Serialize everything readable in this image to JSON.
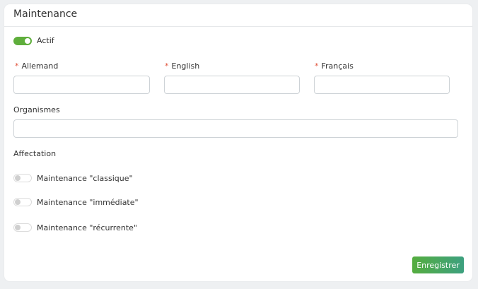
{
  "header": {
    "title": "Maintenance"
  },
  "active_toggle": {
    "label": "Actif",
    "on": true
  },
  "fields": {
    "required_mark": "*",
    "german": {
      "label": "Allemand",
      "value": ""
    },
    "english": {
      "label": "English",
      "value": ""
    },
    "french": {
      "label": "Français",
      "value": ""
    },
    "organisms": {
      "label": "Organismes",
      "value": ""
    }
  },
  "assignment": {
    "title": "Affectation",
    "options": [
      {
        "label": "Maintenance \"classique\"",
        "on": false
      },
      {
        "label": "Maintenance \"immédiate\"",
        "on": false
      },
      {
        "label": "Maintenance \"récurrente\"",
        "on": false
      }
    ]
  },
  "actions": {
    "save_label": "Enregistrer"
  },
  "colors": {
    "accent_green": "#5fae3c",
    "button_gradient_end": "#3da07f",
    "required_red": "#e0533b"
  }
}
